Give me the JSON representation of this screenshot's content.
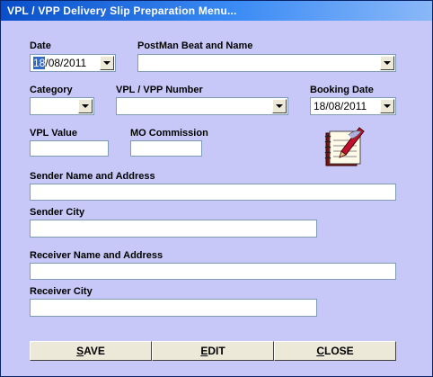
{
  "window": {
    "title": "VPL / VPP  Delivery Slip Preparation Menu..."
  },
  "form": {
    "date_label": "Date",
    "date_value_selected": "18",
    "date_value_rest": "/08/2011",
    "postman_label": "PostMan Beat and Name",
    "postman_value": "",
    "category_label": "Category",
    "category_value": "",
    "vpl_number_label": "VPL / VPP Number",
    "vpl_number_value": "",
    "booking_date_label": "Booking Date",
    "booking_date_value": "18/08/2011",
    "vpl_value_label": "VPL Value",
    "vpl_value_value": "",
    "mo_commission_label": "MO Commission",
    "mo_commission_value": "",
    "sender_name_label": "Sender Name and Address",
    "sender_city_label": "Sender City",
    "receiver_name_label": "Receiver Name and Address",
    "receiver_city_label": "Receiver City"
  },
  "buttons": {
    "save_mnemonic": "S",
    "save_rest": "AVE",
    "edit_mnemonic": "E",
    "edit_rest": "DIT",
    "close_mnemonic": "C",
    "close_rest": "LOSE"
  },
  "icons": {
    "illustration": "notebook-pen-icon"
  }
}
